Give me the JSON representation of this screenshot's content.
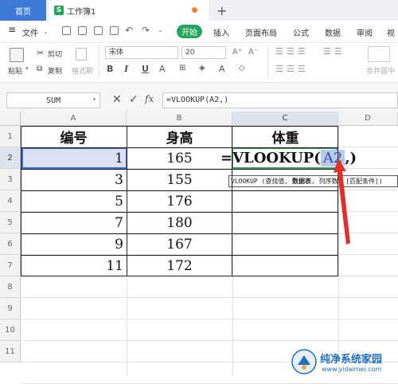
{
  "tabs": {
    "home": "首页",
    "workbook": "工作簿1",
    "new_tab": "+"
  },
  "menu": {
    "file": "文件",
    "start": "开始",
    "items": [
      "插入",
      "页面布局",
      "公式",
      "数据",
      "审阅",
      "视"
    ]
  },
  "ribbon": {
    "paste": "粘贴",
    "cut": "剪切",
    "copy": "复制",
    "format_painter": "格式刷",
    "font": "宋体",
    "font_size": "20",
    "bold": "B",
    "italic": "I",
    "underline": "U",
    "merge_center": "合并居中",
    "font_grow": "A⁺",
    "font_shrink": "A⁻"
  },
  "formula_bar": {
    "name_box": "SUM",
    "formula": "=VLOOKUP(A2,)"
  },
  "sheet": {
    "columns": [
      "A",
      "B",
      "C",
      "D"
    ],
    "rows": [
      "1",
      "2",
      "3",
      "4",
      "5",
      "6",
      "7",
      "8",
      "9",
      "10",
      "11"
    ],
    "header": {
      "a": "编号",
      "b": "身高",
      "c": "体重"
    },
    "data": [
      {
        "a": "1",
        "b": "165"
      },
      {
        "a": "3",
        "b": "155"
      },
      {
        "a": "5",
        "b": "176"
      },
      {
        "a": "7",
        "b": "180"
      },
      {
        "a": "9",
        "b": "167"
      },
      {
        "a": "11",
        "b": "172"
      }
    ],
    "editing_formula": {
      "prefix": "=VLOOKUP(",
      "ref": "A2",
      "suffix": ",)"
    },
    "tooltip": {
      "fn": "VLOOKUP",
      "open": " (查找值, ",
      "bold": "数据表",
      "rest": ", 列序数, [匹配条件])"
    }
  },
  "watermark": {
    "title": "纯净系统家园",
    "url": "www.yidaimei.com"
  },
  "colors": {
    "accent_green": "#23a55a",
    "selection_blue": "#3d6bd1",
    "arrow_red": "#e0302a",
    "home_tab": "#3e7bd8"
  }
}
